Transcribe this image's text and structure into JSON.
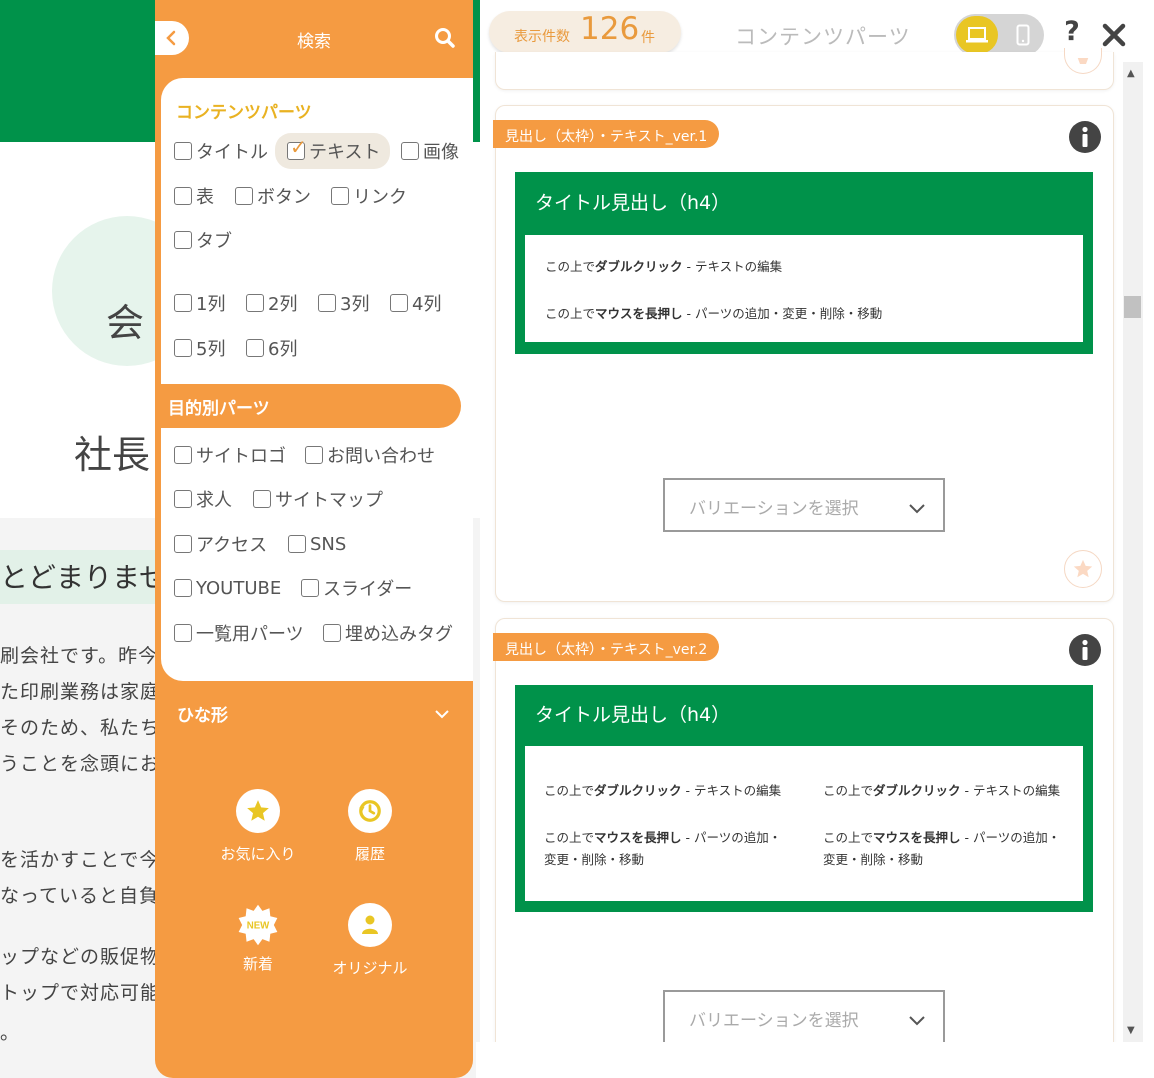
{
  "background": {
    "circle_text": "会",
    "ceo_text": "社長",
    "band_text": "とどまりませ",
    "lines": [
      "刷会社です。昨今",
      "た印刷業務は家庭",
      "そのため、私たちは",
      "うことを念頭にお",
      "を活かすことで今",
      "なっていると自負",
      "ップなどの販促物",
      "トップで対応可能",
      "。"
    ]
  },
  "panel": {
    "title": "検索",
    "content_parts": {
      "title": "コンテンツパーツ",
      "types": [
        {
          "label": "タイトル",
          "checked": false
        },
        {
          "label": "テキスト",
          "checked": true
        },
        {
          "label": "画像",
          "checked": false
        },
        {
          "label": "表",
          "checked": false
        },
        {
          "label": "ボタン",
          "checked": false
        },
        {
          "label": "リンク",
          "checked": false
        },
        {
          "label": "タブ",
          "checked": false
        }
      ],
      "columns": [
        {
          "label": "1列",
          "checked": false
        },
        {
          "label": "2列",
          "checked": false
        },
        {
          "label": "3列",
          "checked": false
        },
        {
          "label": "4列",
          "checked": false
        },
        {
          "label": "5列",
          "checked": false
        },
        {
          "label": "6列",
          "checked": false
        }
      ]
    },
    "purpose_parts": {
      "title": "目的別パーツ",
      "items": [
        {
          "label": "サイトロゴ",
          "checked": false
        },
        {
          "label": "お問い合わせ",
          "checked": false
        },
        {
          "label": "求人",
          "checked": false
        },
        {
          "label": "サイトマップ",
          "checked": false
        },
        {
          "label": "アクセス",
          "checked": false
        },
        {
          "label": "SNS",
          "checked": false
        },
        {
          "label": "YOUTUBE",
          "checked": false
        },
        {
          "label": "スライダー",
          "checked": false
        },
        {
          "label": "一覧用パーツ",
          "checked": false
        },
        {
          "label": "埋め込みタグ",
          "checked": false
        }
      ]
    },
    "templates": {
      "title": "ひな形"
    },
    "shortcuts": [
      {
        "label": "お気に入り",
        "icon": "star-icon"
      },
      {
        "label": "履歴",
        "icon": "history-icon"
      },
      {
        "label": "新着",
        "icon": "new-badge-icon",
        "badge": "NEW"
      },
      {
        "label": "オリジナル",
        "icon": "user-icon"
      }
    ]
  },
  "toolbar": {
    "count_label": "表示件数",
    "count": "126",
    "count_unit": "件",
    "title": "コンテンツパーツ",
    "help": "?"
  },
  "cards": [
    {
      "tag": "見出し（太枠）・テキスト_ver.1",
      "heading": "タイトル見出し（h4）",
      "col1": {
        "l1_pre": "この上で",
        "l1_bold": "ダブルクリック",
        "l1_post": " - テキストの編集",
        "l2_pre": "この上で",
        "l2_bold": "マウスを長押し",
        "l2_post": " - パーツの追加・変更・削除・移動"
      },
      "variation": "バリエーションを選択"
    },
    {
      "tag": "見出し（太枠）・テキスト_ver.2",
      "heading": "タイトル見出し（h4）",
      "col1": {
        "l1_pre": "この上で",
        "l1_bold": "ダブルクリック",
        "l1_post": " - テキストの編集",
        "l2_pre": "この上で",
        "l2_bold": "マウスを長押し",
        "l2_post": " - パーツの追加・",
        "l3": "変更・削除・移動"
      },
      "col2": {
        "l1_pre": "この上で",
        "l1_bold": "ダブルクリック",
        "l1_post": " - テキストの編集",
        "l2_pre": "この上で",
        "l2_bold": "マウスを長押し",
        "l2_post": " - パーツの追加・",
        "l3": "変更・削除・移動"
      },
      "variation": "バリエーションを選択"
    }
  ],
  "colors": {
    "accent": "#f59b42",
    "green": "#00924a",
    "yellow": "#e9c624",
    "section_title": "#e9b222"
  }
}
